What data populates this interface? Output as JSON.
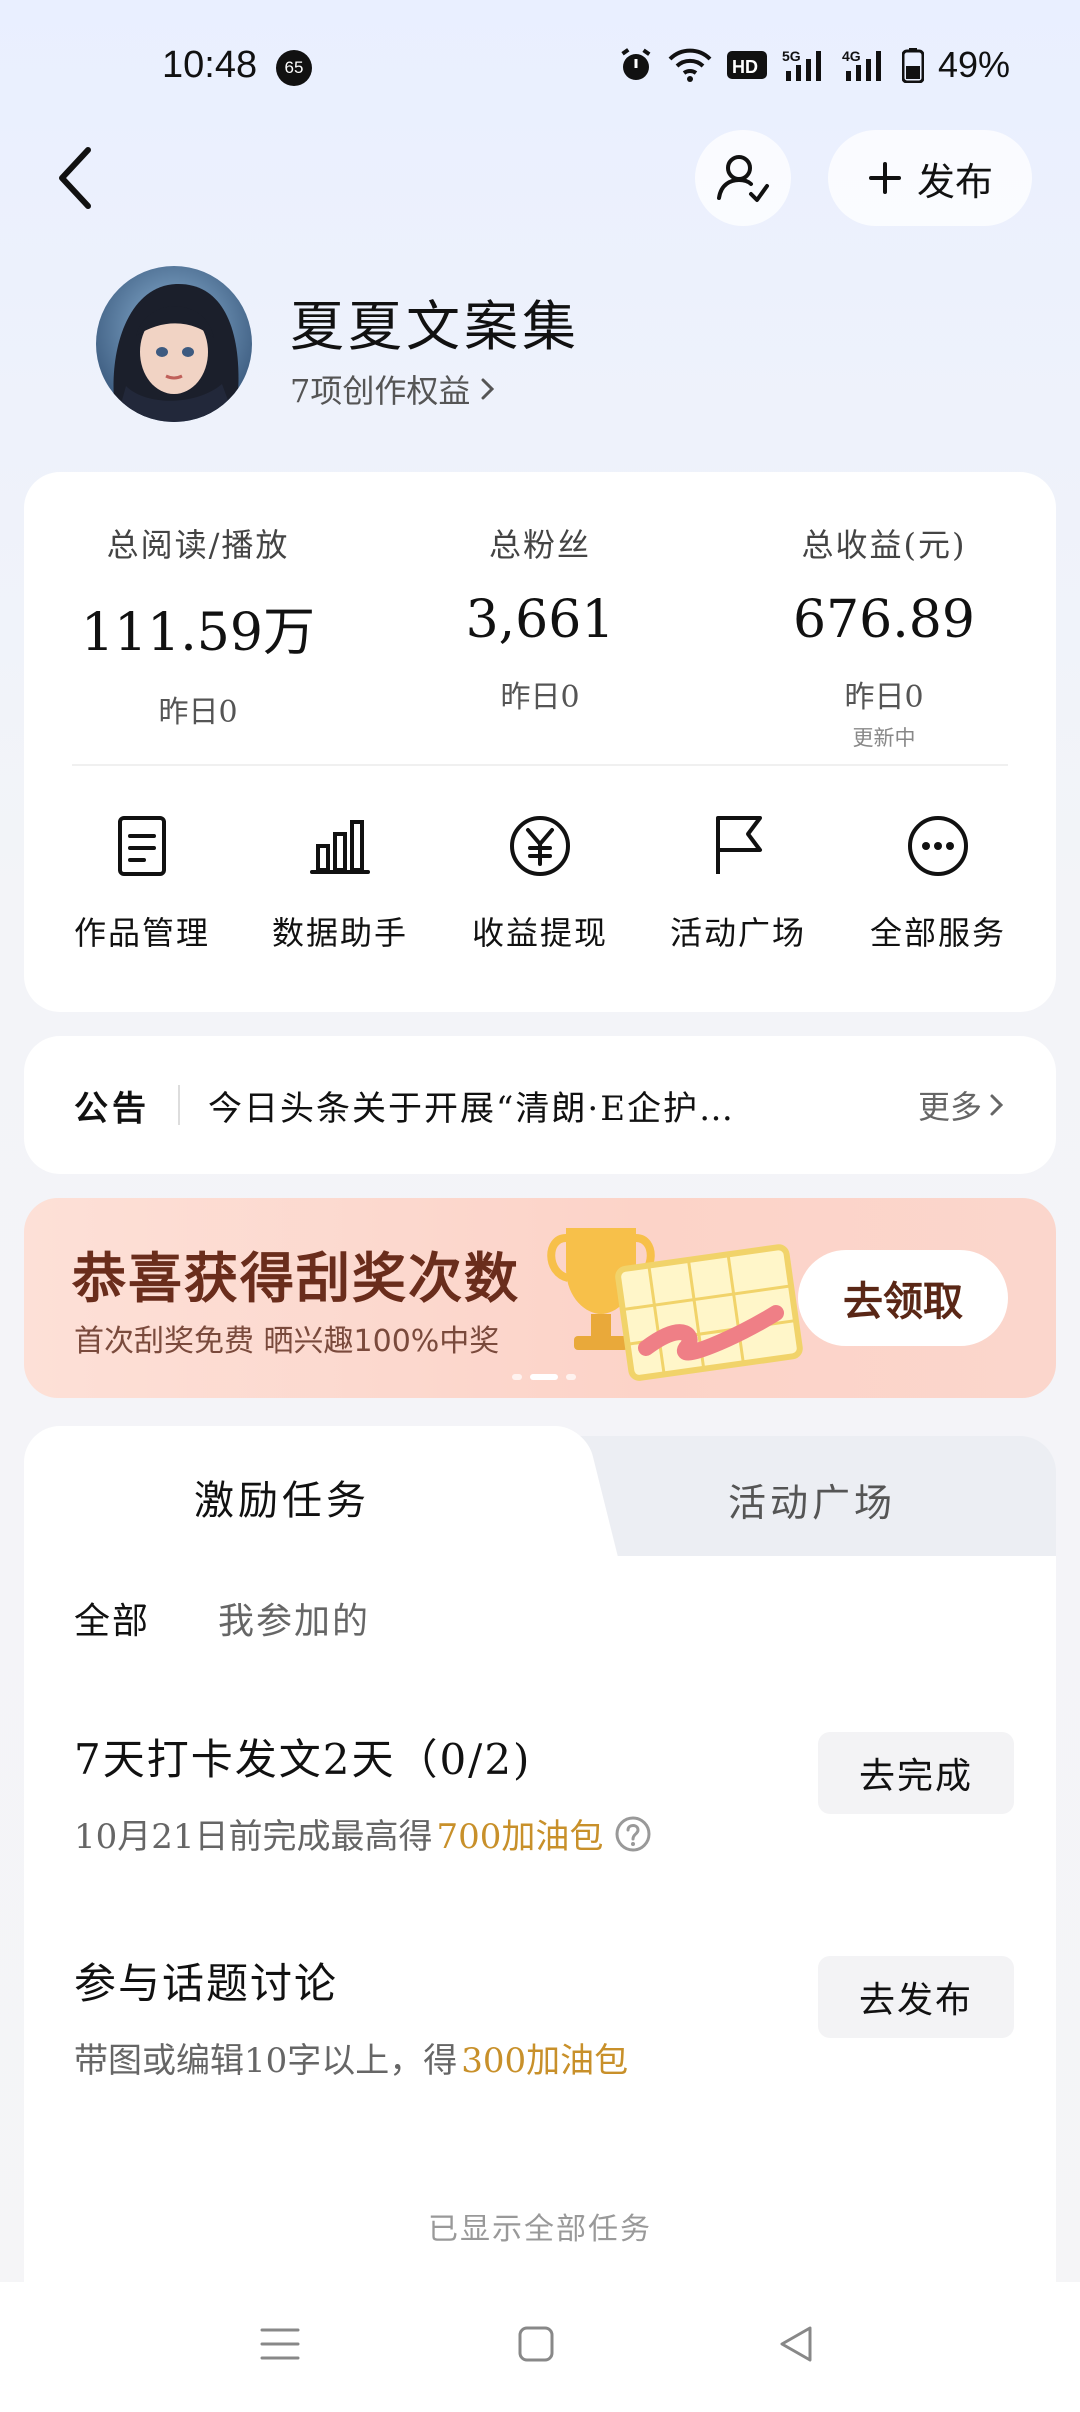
{
  "status_bar": {
    "time": "10:48",
    "notification_badge": "65",
    "network_icons": [
      "alarm-icon",
      "wifi-icon",
      "hd-icon",
      "5g-signal-icon",
      "4g-signal-icon",
      "battery-icon"
    ],
    "battery": "49%"
  },
  "header": {
    "publish_label": "发布"
  },
  "profile": {
    "name": "夏夏文案集",
    "benefits": "7项创作权益"
  },
  "stats": [
    {
      "label": "总阅读/播放",
      "value": "111.59万",
      "yesterday": "昨日0",
      "note": ""
    },
    {
      "label": "总粉丝",
      "value": "3,661",
      "yesterday": "昨日0",
      "note": ""
    },
    {
      "label": "总收益(元)",
      "value": "676.89",
      "yesterday": "昨日0",
      "note": "更新中"
    }
  ],
  "services": [
    {
      "label": "作品管理",
      "icon": "document-icon"
    },
    {
      "label": "数据助手",
      "icon": "bar-chart-icon"
    },
    {
      "label": "收益提现",
      "icon": "yuan-icon"
    },
    {
      "label": "活动广场",
      "icon": "flag-icon"
    },
    {
      "label": "全部服务",
      "icon": "more-icon"
    }
  ],
  "notice": {
    "key": "公告",
    "text": "今日头条关于开展“清朗·E企护…",
    "more": "更多"
  },
  "banner": {
    "title": "恭喜获得刮奖次数",
    "subtitle": "首次刮奖免费 晒兴趣100%中奖",
    "button": "去领取"
  },
  "tasks": {
    "tabs": [
      "激励任务",
      "活动广场"
    ],
    "filters": [
      "全部",
      "我参加的"
    ],
    "items": [
      {
        "title": "7天打卡发文2天（0/2)",
        "desc_prefix": "10月21日前完成最高得",
        "reward": "700加油包",
        "button": "去完成"
      },
      {
        "title": "参与话题讨论",
        "desc_prefix": "带图或编辑10字以上，得",
        "reward": "300加油包",
        "button": "去发布"
      }
    ],
    "footer": "已显示全部任务"
  },
  "colors": {
    "accent_gold": "#c8902a",
    "banner_bg": "#fcd6cb"
  }
}
